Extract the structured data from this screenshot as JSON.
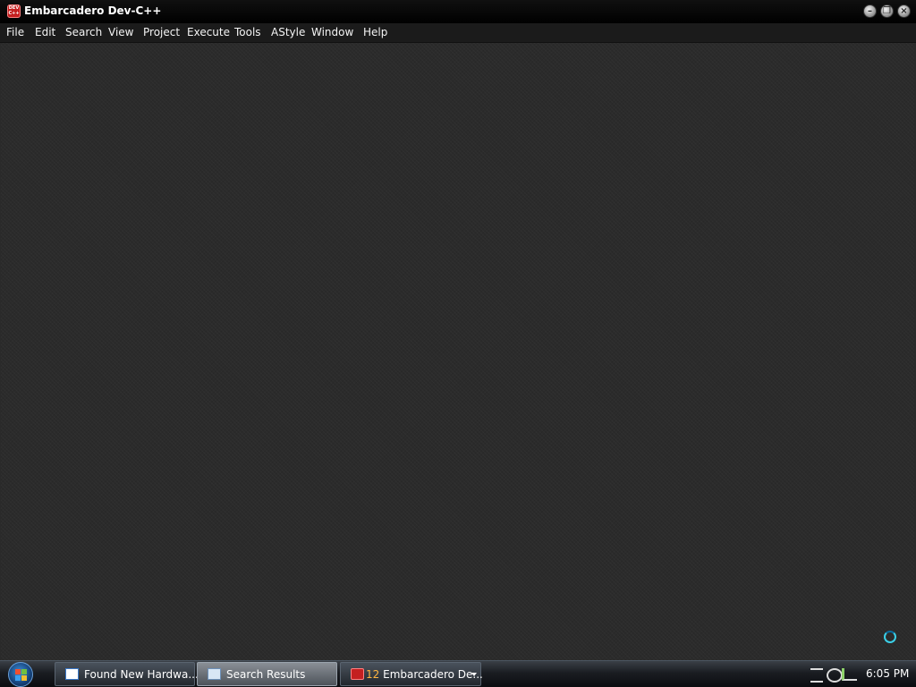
{
  "window": {
    "title": "Embarcadero Dev-C++",
    "app_icon_text": "DEV C++"
  },
  "menubar": {
    "items": [
      {
        "label": "File"
      },
      {
        "label": "Edit"
      },
      {
        "label": "Search"
      },
      {
        "label": "View"
      },
      {
        "label": "Project"
      },
      {
        "label": "Execute"
      },
      {
        "label": "Tools"
      },
      {
        "label": "AStyle"
      },
      {
        "label": "Window"
      },
      {
        "label": "Help"
      }
    ]
  },
  "window_controls": {
    "minimize": "minimize-icon",
    "restore": "restore-icon",
    "close": "close-icon"
  },
  "workspace": {
    "cursor": "busy-cursor-icon"
  },
  "taskbar": {
    "start_icon": "windows-start-orb-icon",
    "buttons": [
      {
        "label": "Found New Hardwa...",
        "icon": "window-icon",
        "active": false
      },
      {
        "label": "Search Results",
        "icon": "search-results-icon",
        "active": true
      },
      {
        "count": "12",
        "label": "Embarcadero De...",
        "icon": "devcpp-icon",
        "active": false
      }
    ],
    "tray_icons": [
      "network-icon",
      "volume-icon",
      "sync-icon"
    ],
    "clock": "6:05 PM"
  },
  "colors": {
    "workspace_bg": "#2b2b2b",
    "titlebar_bg": "#000000",
    "menu_bg": "#1b1b1b",
    "busy_cursor": "#3bd0e8",
    "taskbar_count": "#ffb640"
  }
}
